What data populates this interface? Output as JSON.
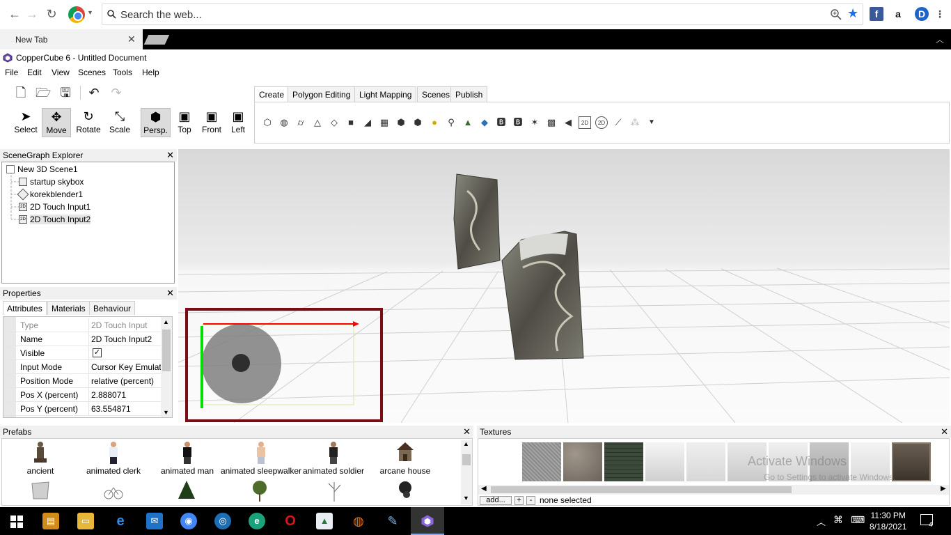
{
  "browser": {
    "omnibox_placeholder": "Search the web...",
    "tab_title": "New Tab",
    "nav_back": "←",
    "nav_forward": "→",
    "nav_reload": "↻",
    "ext_facebook": "f",
    "ext_amazon": "a",
    "ext_profile": "D"
  },
  "app": {
    "title": "CopperCube 6 - Untitled Document",
    "menu": [
      "File",
      "Edit",
      "View",
      "Scenes",
      "Tools",
      "Help"
    ],
    "tools": [
      "Select",
      "Move",
      "Rotate",
      "Scale"
    ],
    "views": [
      "Persp.",
      "Top",
      "Front",
      "Left"
    ],
    "create_tabs": [
      "Create",
      "Polygon Editing",
      "Light Mapping",
      "Scenes",
      "Publish"
    ]
  },
  "scenegraph": {
    "title": "SceneGraph Explorer",
    "root": "New 3D Scene1",
    "nodes": [
      {
        "label": "startup skybox",
        "icon": "skybox-icon"
      },
      {
        "label": "korekblender1",
        "icon": "mesh-icon"
      },
      {
        "label": "2D Touch Input1",
        "icon": "2d-icon"
      },
      {
        "label": "2D Touch Input2",
        "icon": "2d-icon"
      }
    ],
    "selected_index": 3
  },
  "properties": {
    "title": "Properties",
    "tabs": [
      "Attributes",
      "Materials",
      "Behaviour"
    ],
    "rows": [
      {
        "key": "Type",
        "value": "2D Touch Input"
      },
      {
        "key": "Name",
        "value": "2D Touch Input2"
      },
      {
        "key": "Visible",
        "value": ""
      },
      {
        "key": "Input Mode",
        "value": "Cursor Key Emulat"
      },
      {
        "key": "Position Mode",
        "value": "relative (percent)"
      },
      {
        "key": "Pos X (percent)",
        "value": "2.888071"
      },
      {
        "key": "Pos Y (percent)",
        "value": "63.554871"
      }
    ],
    "visible_checked": true
  },
  "prefabs": {
    "title": "Prefabs",
    "items": [
      "ancient",
      "animated clerk",
      "animated man",
      "animated sleepwalker",
      "animated soldier",
      "arcane house"
    ]
  },
  "textures": {
    "title": "Textures",
    "add_label": "add...",
    "plus_label": "+",
    "minus_label": "-",
    "status": "none selected",
    "watermark_title": "Activate Windows",
    "watermark_sub": "Go to Settings to activate Windows."
  },
  "taskbar": {
    "time": "11:30 PM",
    "date": "8/18/2021",
    "notification_count": "4"
  },
  "colors": {
    "touch_border": "#7a0c16",
    "axis_x": "#ff0000",
    "axis_y": "#00e000",
    "accent": "#1a73e8"
  }
}
